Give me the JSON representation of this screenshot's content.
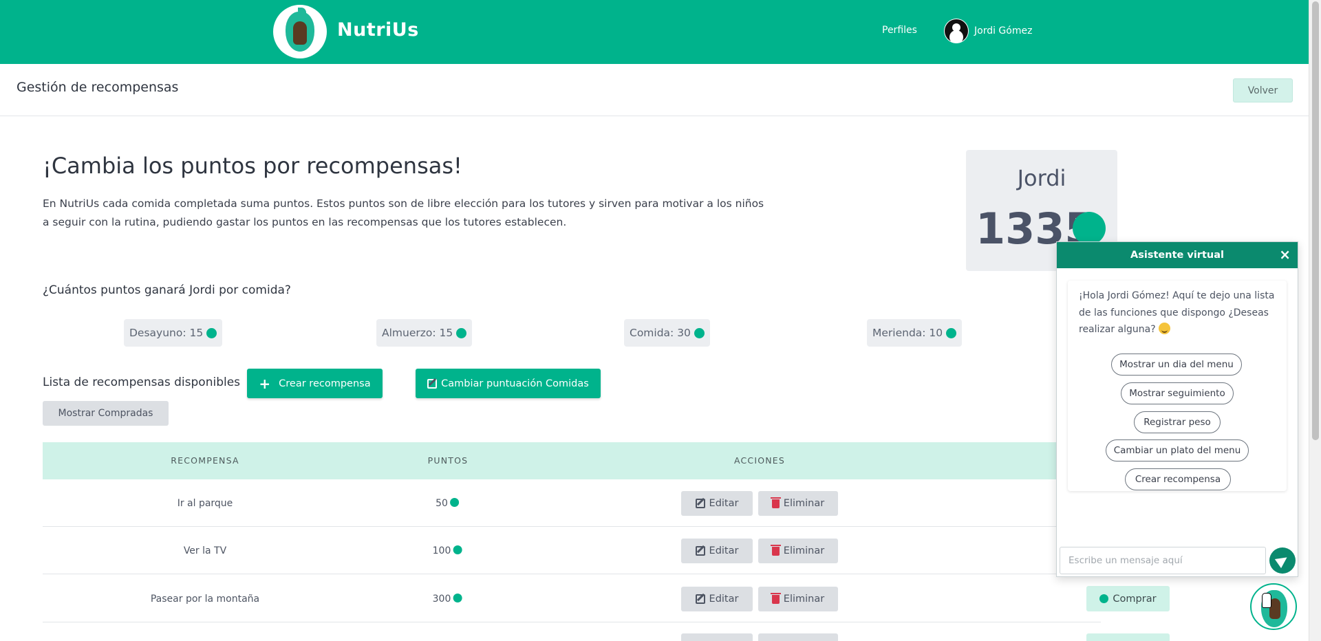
{
  "brand": {
    "name": "NutriUs"
  },
  "nav": {
    "profiles": "Perfiles",
    "user_name": "Jordi Gómez"
  },
  "subheader": {
    "title": "Gestión de recompensas",
    "back_label": "Volver"
  },
  "main": {
    "title": "¡Cambia los puntos por recompensas!",
    "intro_line1": "En NutriUs cada comida completada suma puntos. Estos puntos son de libre elección para los tutores y sirven para motivar a los niños",
    "intro_line2": "a seguir con la rutina, pudiendo gastar los puntos en las recompensas que los tutores establecen."
  },
  "points_card": {
    "name": "Jordi",
    "points": "1335"
  },
  "meals": {
    "question": "¿Cuántos puntos ganará Jordi por comida?",
    "items": [
      {
        "label": "Desayuno: 15"
      },
      {
        "label": "Almuerzo: 15"
      },
      {
        "label": "Comida: 30"
      },
      {
        "label": "Merienda: 10"
      }
    ]
  },
  "rewards": {
    "list_title": "Lista de recompensas disponibles",
    "create_label": "Crear recompensa",
    "change_scores_label": "Cambiar puntuación Comidas",
    "show_bought_label": "Mostrar Compradas",
    "columns": [
      "RECOMPENSA",
      "PUNTOS",
      "ACCIONES"
    ],
    "edit_label": "Editar",
    "delete_label": "Eliminar",
    "buy_label": "Comprar",
    "rows": [
      {
        "name": "Ir al parque",
        "points": "50"
      },
      {
        "name": "Ver la TV",
        "points": "100"
      },
      {
        "name": "Pasear por la montaña",
        "points": "300"
      }
    ]
  },
  "chat": {
    "title": "Asistente virtual",
    "close": "×",
    "message": "¡Hola Jordi Gómez! Aquí te dejo una lista de las funciones que dispongo ¿Deseas realizar alguna?",
    "options": [
      "Mostrar un dia del menu",
      "Mostrar seguimiento",
      "Registrar peso",
      "Cambiar un plato del menu",
      "Crear recompensa"
    ],
    "input_placeholder": "Escribe un mensaje aquí"
  },
  "colors": {
    "primary": "#00b38c",
    "chat_header": "#0b8a6e",
    "light_accent": "#cff2e8",
    "danger": "#d9364c"
  },
  "icons": [
    "logo-icon",
    "avatar-icon",
    "coin-icon",
    "plus-icon",
    "edit-icon",
    "trash-icon",
    "close-icon",
    "send-icon",
    "chatbot-icon",
    "emoji-icon"
  ]
}
